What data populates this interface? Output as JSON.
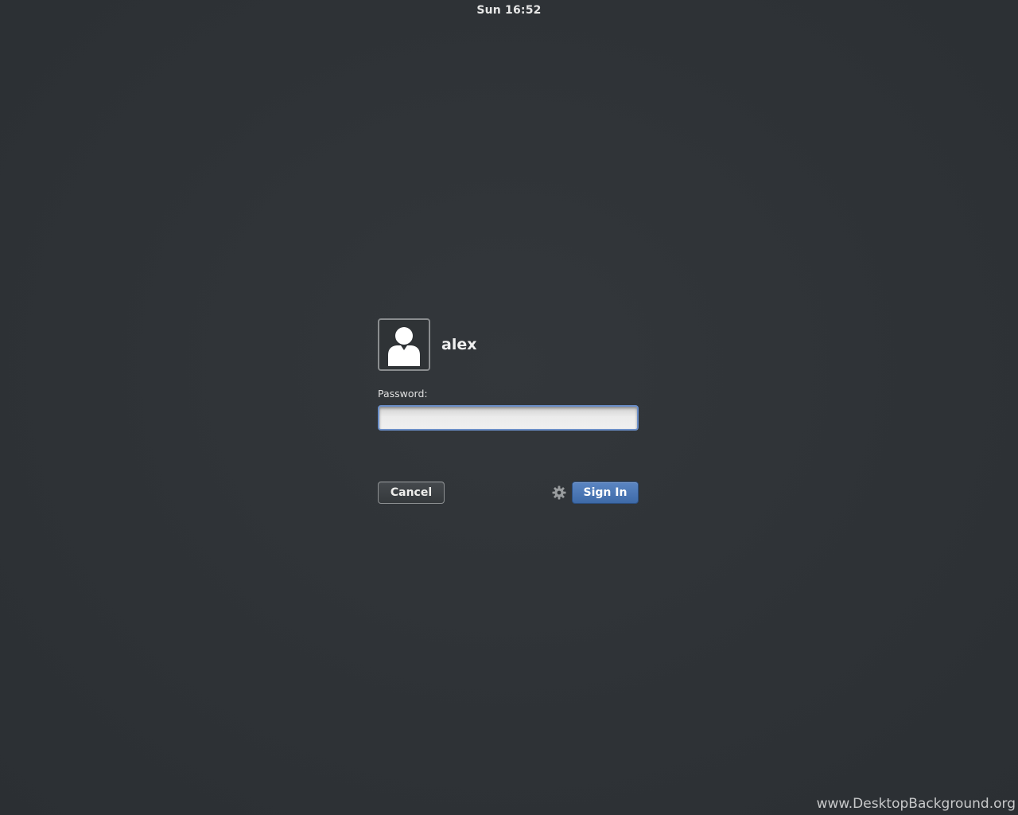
{
  "top_bar": {
    "clock": "Sun 16:52"
  },
  "login": {
    "avatar_icon": "user-silhouette-icon",
    "user_name": "alex",
    "password_label": "Password:",
    "password_value": "",
    "cancel_label": "Cancel",
    "settings_icon": "gear-icon",
    "sign_in_label": "Sign In"
  },
  "watermark": "www.DesktopBackground.org",
  "colors": {
    "background": "#2e3236",
    "accent": "#4a76b4",
    "input_focus_border": "#6a8ec8"
  }
}
